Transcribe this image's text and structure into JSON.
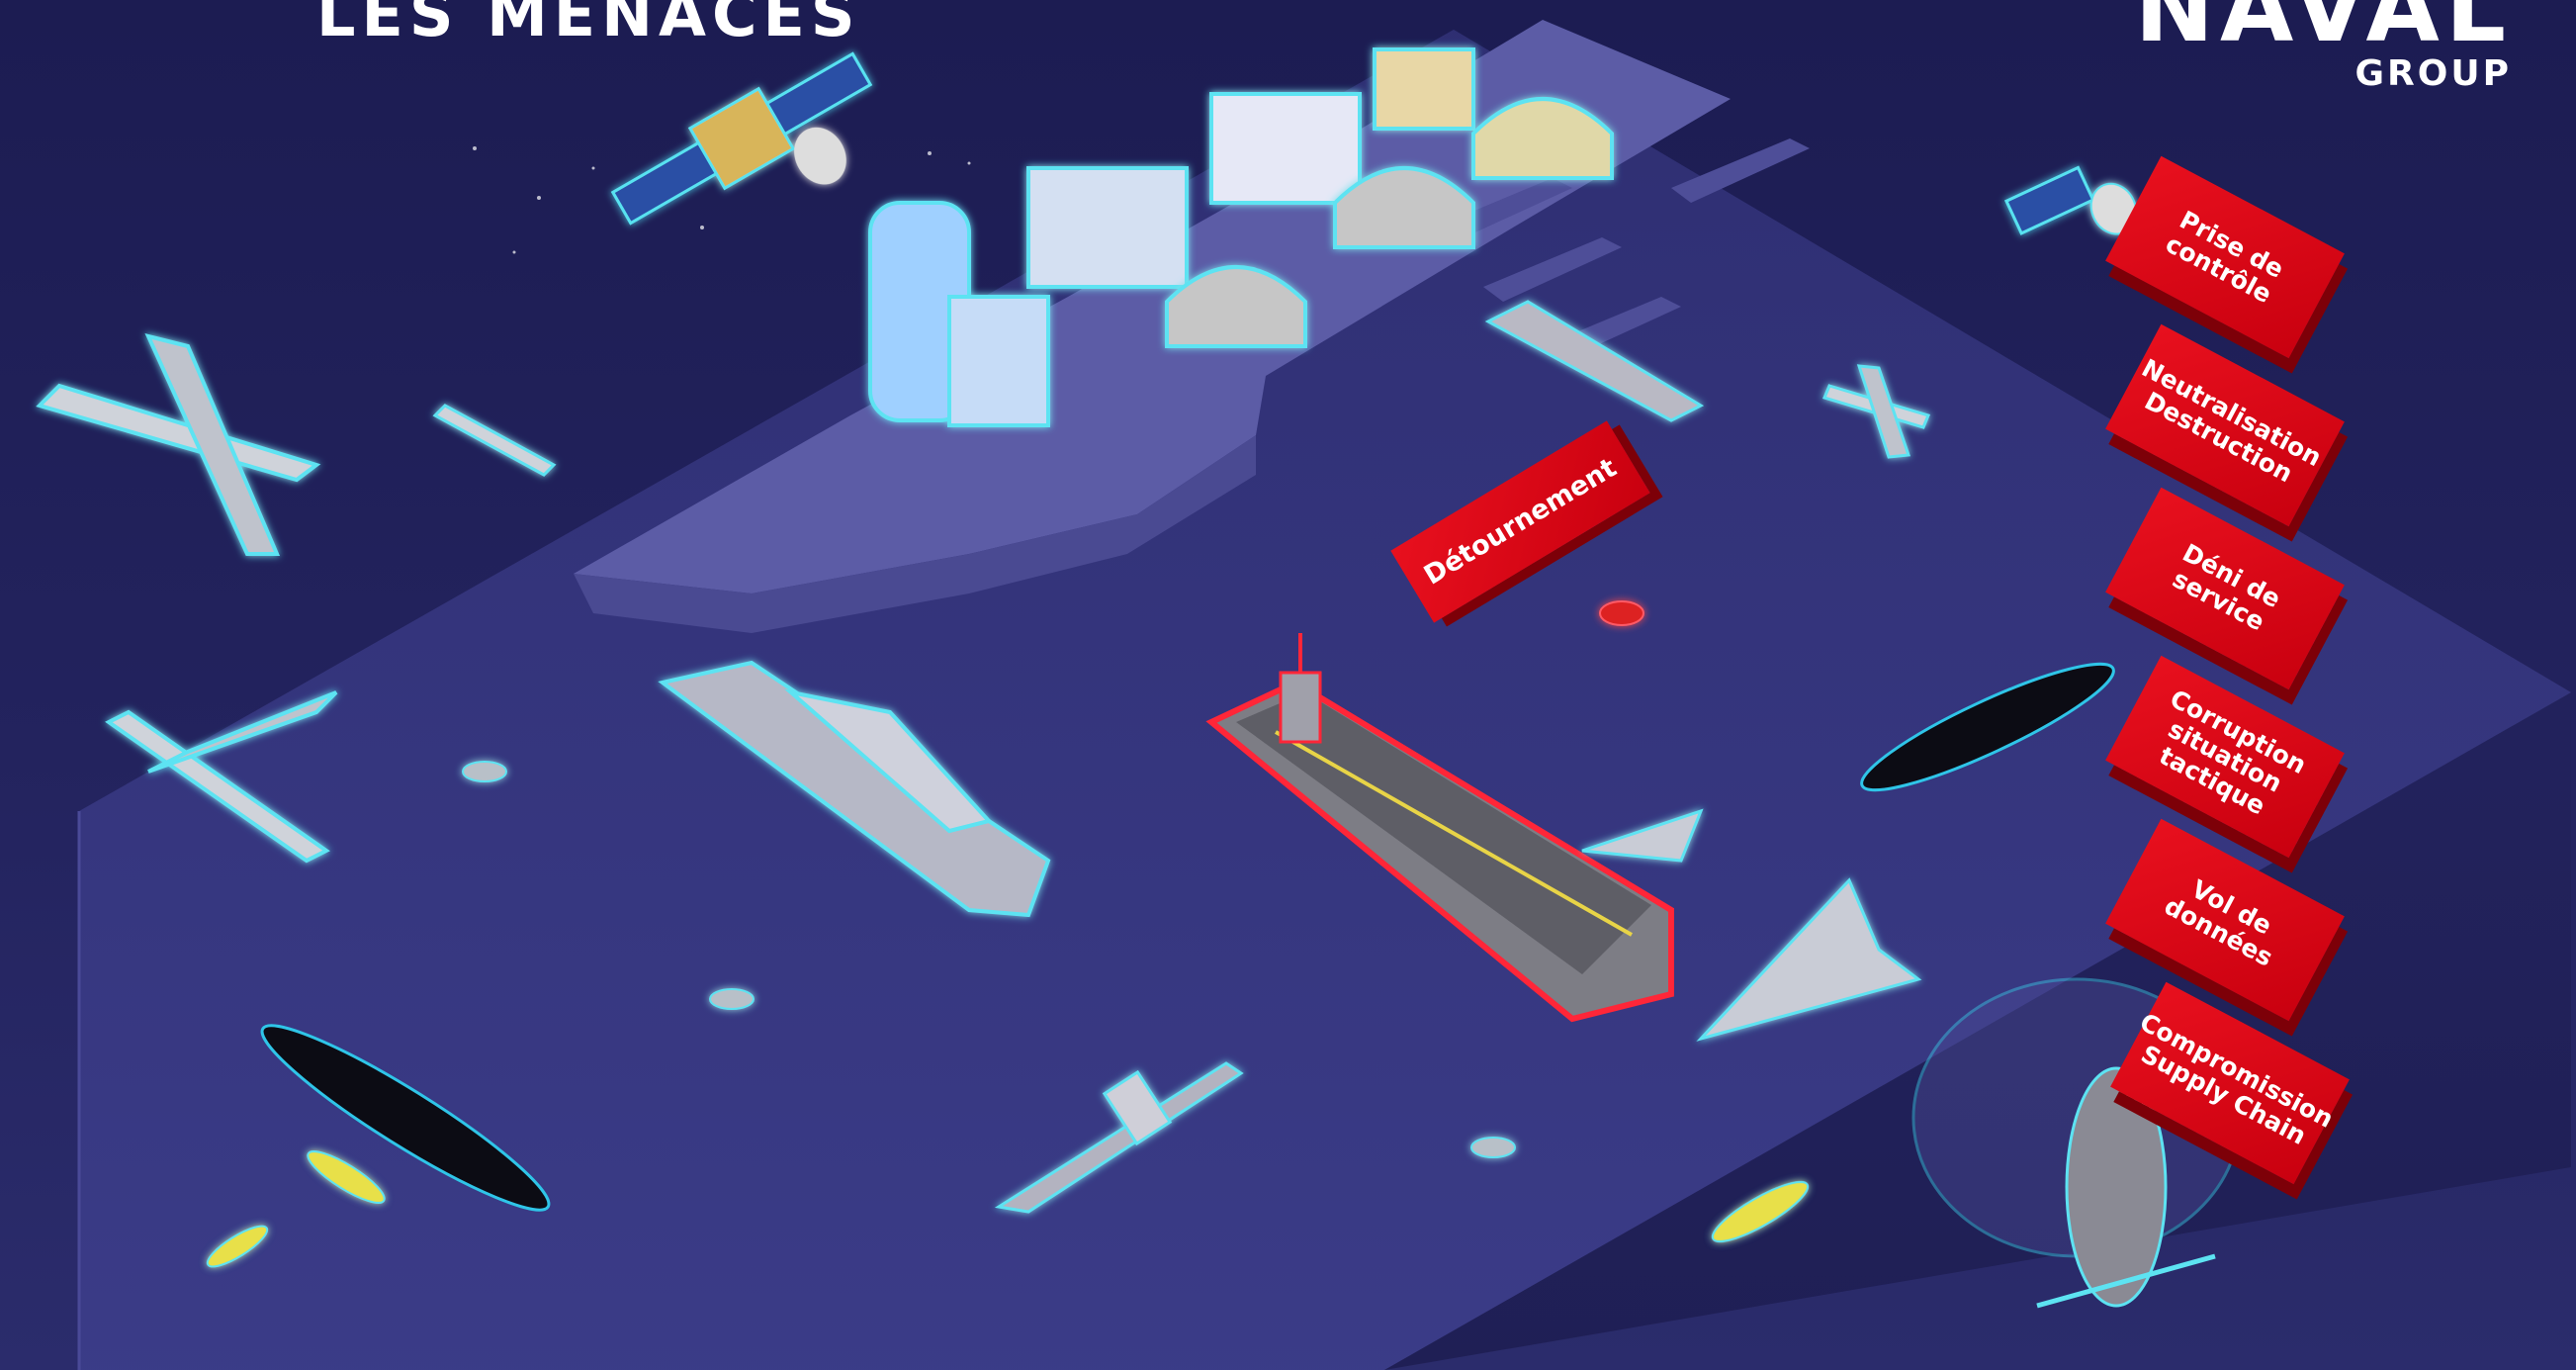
{
  "title": "LES MENACES",
  "logo": {
    "top": "NAVAL",
    "bottom": "GROUP"
  },
  "threats": {
    "detournement": "Détournement",
    "prise_controle": "Prise de\ncontrôle",
    "neutralisation": "Neutralisation\nDestruction",
    "deni_service": "Déni de\nservice",
    "corruption": "Corruption\nsituation\ntactique",
    "vol_donnees": "Vol de données",
    "compromission": "Compromission\nSupply Chain"
  },
  "colors": {
    "background": "#22225c",
    "ocean": "#3a3a86",
    "threat_red": "#d4000f",
    "glow": "#4de3f0"
  },
  "icons": [
    "satellite-icon",
    "drone-icon",
    "building-icon",
    "hangar-icon",
    "frigate-icon",
    "aircraft-carrier-icon",
    "submarine-icon",
    "helicopter-icon",
    "torpedo-icon",
    "small-boat-icon",
    "uav-icon"
  ]
}
